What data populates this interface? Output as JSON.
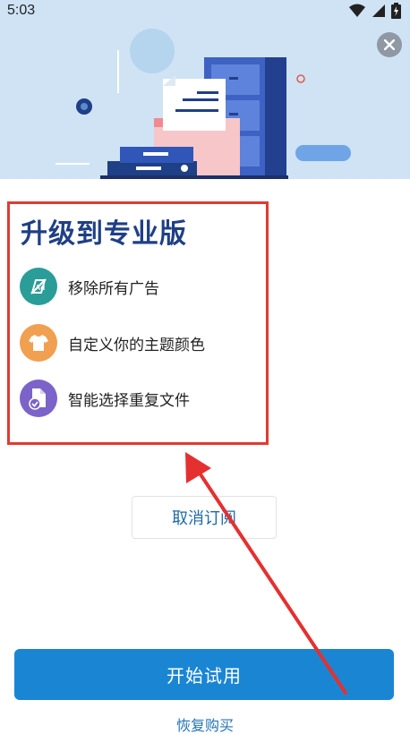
{
  "status_bar": {
    "time": "5:03",
    "icons": [
      "wifi-icon",
      "cellular-signal-icon",
      "battery-charging-icon"
    ]
  },
  "header": {
    "close_icon": "close-icon"
  },
  "features": {
    "title": "升级到专业版",
    "items": [
      {
        "label": "移除所有广告",
        "icon": "no-ads-icon",
        "color": "#2a9d98"
      },
      {
        "label": "自定义你的主题颜色",
        "icon": "tshirt-icon",
        "color": "#f0a050"
      },
      {
        "label": "智能选择重复文件",
        "icon": "file-check-icon",
        "color": "#7b63c9"
      }
    ]
  },
  "actions": {
    "cancel_label": "取消订阅",
    "start_label": "开始试用",
    "restore_label": "恢复购买"
  },
  "colors": {
    "accent": "#1a86d3",
    "title": "#1f3f86",
    "highlight_border": "#e23a32",
    "hero_bg": "#cfe3f5"
  }
}
